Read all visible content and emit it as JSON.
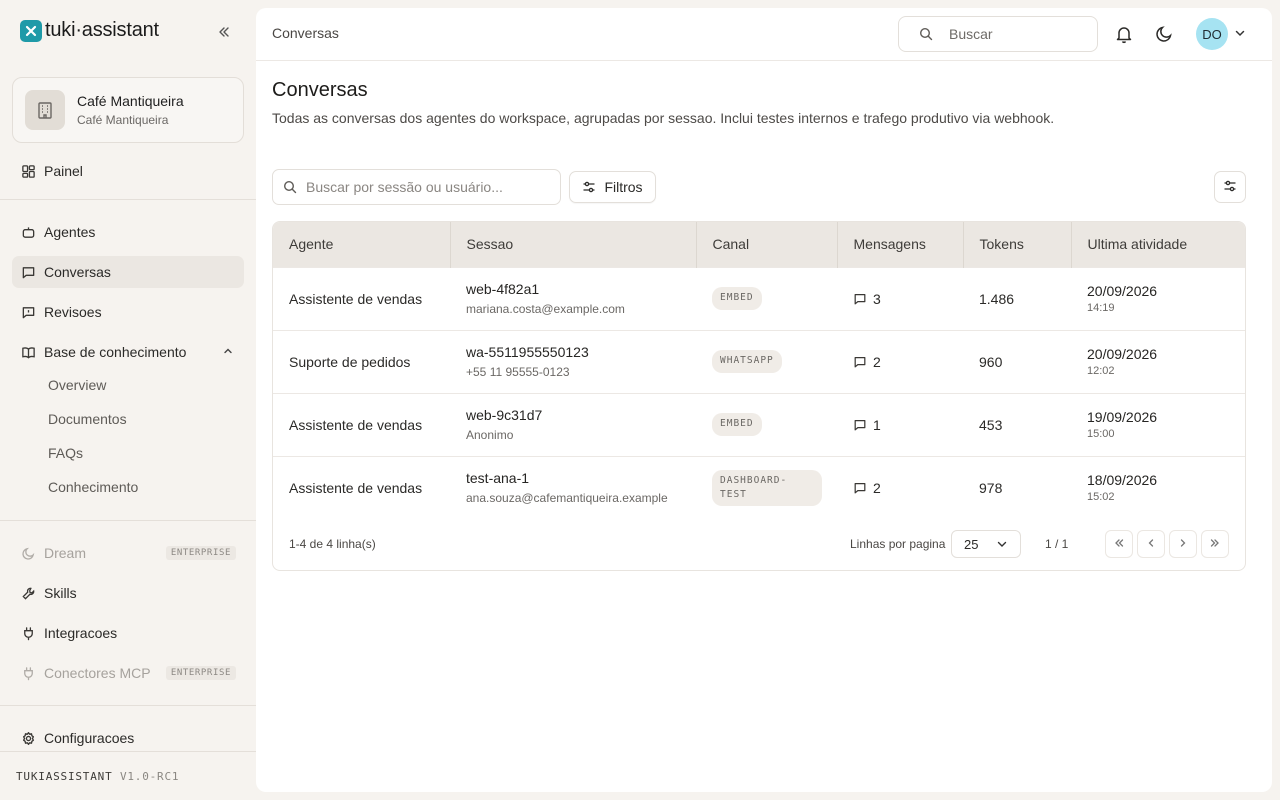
{
  "brand": {
    "name": "tuki·assistant"
  },
  "workspace": {
    "name": "Café Mantiqueira",
    "sub": "Café Mantiqueira"
  },
  "nav": {
    "painel": "Painel",
    "agentes": "Agentes",
    "conversas": "Conversas",
    "revisoes": "Revisoes",
    "base": "Base de conhecimento",
    "sub_items": [
      "Overview",
      "Documentos",
      "FAQs",
      "Conhecimento"
    ],
    "dream": "Dream",
    "skills": "Skills",
    "integracoes": "Integracoes",
    "conectores": "Conectores MCP",
    "configuracoes": "Configuracoes",
    "enterprise_badge": "ENTERPRISE"
  },
  "version": {
    "name": "TUKIASSISTANT",
    "number": "V1.0-RC1"
  },
  "topbar": {
    "breadcrumb": "Conversas",
    "search_placeholder": "Buscar",
    "avatar_initials": "DO"
  },
  "page": {
    "title": "Conversas",
    "description": "Todas as conversas dos agentes do workspace, agrupadas por sessao. Inclui testes internos e trafego produtivo via webhook."
  },
  "toolbar": {
    "search_placeholder": "Buscar por sessão ou usuário...",
    "filters_label": "Filtros"
  },
  "table": {
    "headers": [
      "Agente",
      "Sessao",
      "Canal",
      "Mensagens",
      "Tokens",
      "Ultima atividade"
    ],
    "rows": [
      {
        "agent": "Assistente de vendas",
        "session": "web-4f82a1",
        "user": "mariana.costa@example.com",
        "channel": "EMBED",
        "messages": "3",
        "tokens": "1.486",
        "date": "20/09/2026",
        "time": "14:19"
      },
      {
        "agent": "Suporte de pedidos",
        "session": "wa-5511955550123",
        "user": "+55 11 95555-0123",
        "channel": "WHATSAPP",
        "messages": "2",
        "tokens": "960",
        "date": "20/09/2026",
        "time": "12:02"
      },
      {
        "agent": "Assistente de vendas",
        "session": "web-9c31d7",
        "user": "Anonimo",
        "channel": "EMBED",
        "messages": "1",
        "tokens": "453",
        "date": "19/09/2026",
        "time": "15:00"
      },
      {
        "agent": "Assistente de vendas",
        "session": "test-ana-1",
        "user": "ana.souza@cafemantiqueira.example",
        "channel": "DASHBOARD-TEST",
        "messages": "2",
        "tokens": "978",
        "date": "18/09/2026",
        "time": "15:02"
      }
    ]
  },
  "footer": {
    "count": "1-4 de 4 linha(s)",
    "rows_label": "Linhas por pagina",
    "rows_value": "25",
    "page": "1 / 1"
  },
  "colors": {
    "accent": "#1f9aa8",
    "avatar": "#a6e3f2",
    "active_nav": "#ebe7e2"
  }
}
